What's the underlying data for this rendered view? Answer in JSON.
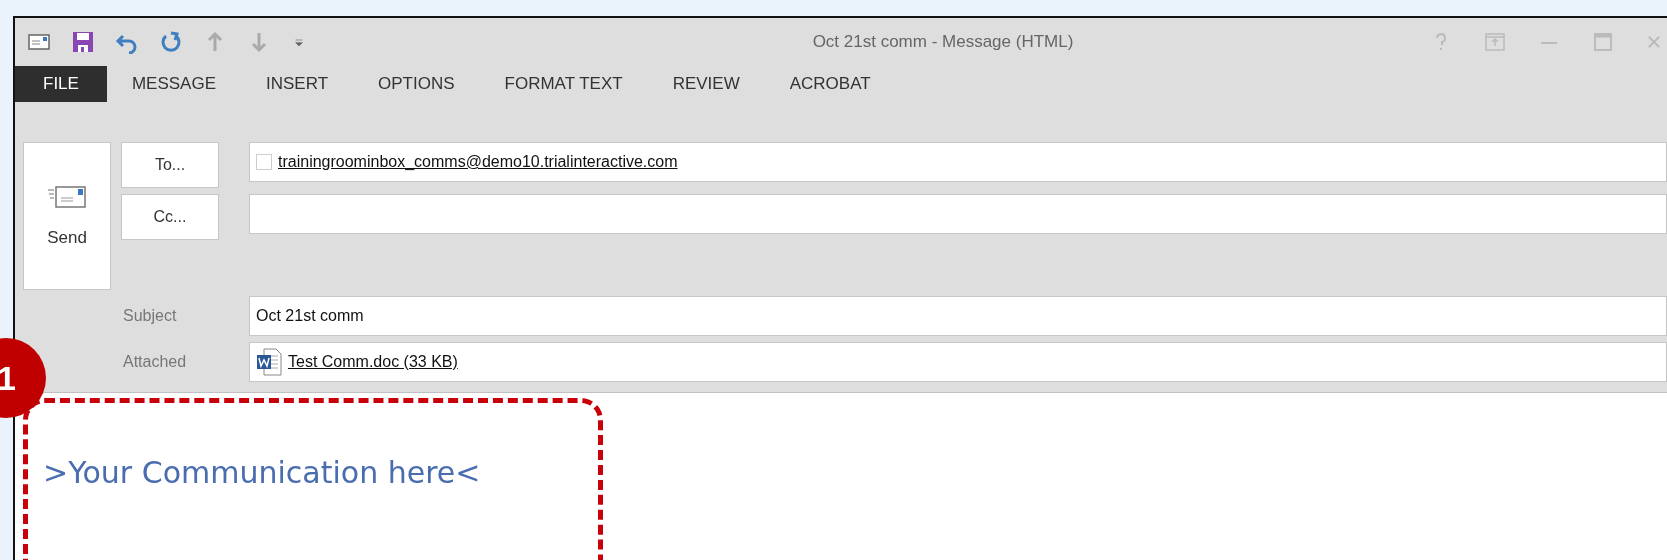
{
  "window": {
    "title": "Oct 21st comm - Message (HTML)"
  },
  "ribbon_tabs": [
    {
      "label": "FILE",
      "selected": true
    },
    {
      "label": "MESSAGE",
      "selected": false
    },
    {
      "label": "INSERT",
      "selected": false
    },
    {
      "label": "OPTIONS",
      "selected": false
    },
    {
      "label": "FORMAT TEXT",
      "selected": false
    },
    {
      "label": "REVIEW",
      "selected": false
    },
    {
      "label": "ACROBAT",
      "selected": false
    }
  ],
  "header": {
    "send_button": "Send",
    "to_button": "To...",
    "to_value": "trainingroominbox_comms@demo10.trialinteractive.com",
    "cc_button": "Cc...",
    "subject_label": "Subject",
    "subject_value": "Oct 21st comm",
    "attached_label": "Attached",
    "attachment": "Test Comm.doc (33 KB)"
  },
  "body": {
    "text": ">Your Communication here<"
  },
  "callout": {
    "number": "1"
  }
}
